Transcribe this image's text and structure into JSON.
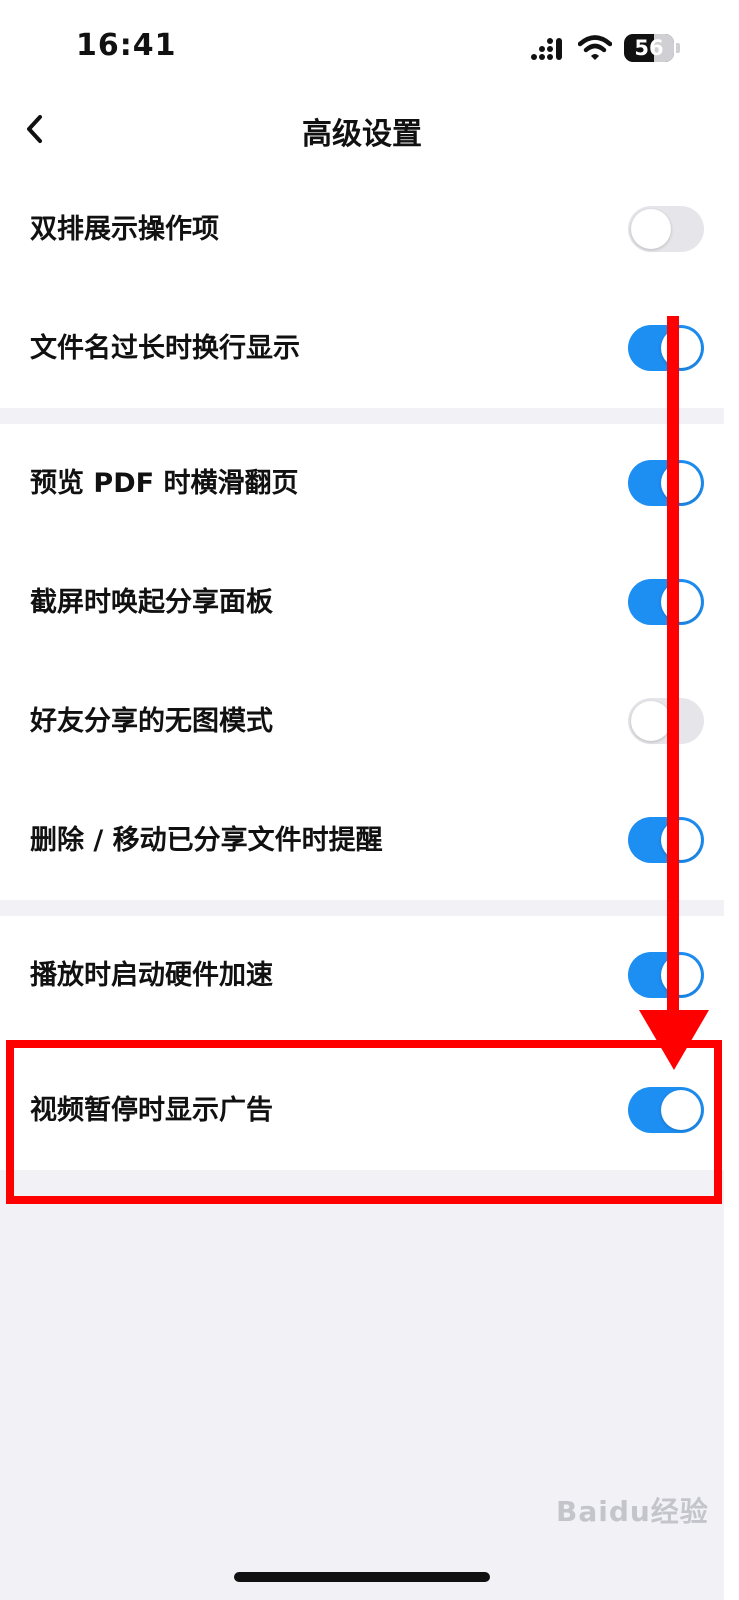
{
  "status_bar": {
    "time": "16:41",
    "battery": "56",
    "signal_icon": "cellular-signal-icon",
    "wifi_icon": "wifi-icon",
    "battery_icon": "battery-icon"
  },
  "nav": {
    "title": "高级设置",
    "back_icon": "chevron-left-icon"
  },
  "sections": [
    {
      "items": [
        {
          "label": "双排展示操作项",
          "on": false
        },
        {
          "label": "文件名过长时换行显示",
          "on": true
        }
      ]
    },
    {
      "items": [
        {
          "label": "预览 PDF 时横滑翻页",
          "on": true
        },
        {
          "label": "截屏时唤起分享面板",
          "on": true
        },
        {
          "label": "好友分享的无图模式",
          "on": false
        },
        {
          "label": "删除 / 移动已分享文件时提醒",
          "on": true
        }
      ]
    },
    {
      "items": [
        {
          "label": "播放时启动硬件加速",
          "on": true
        },
        {
          "label": "视频暂停时显示广告",
          "on": true
        }
      ]
    }
  ],
  "colors": {
    "toggle_on": "#1d8ef2",
    "toggle_off": "#e6e6ea",
    "annotation": "#ff0000",
    "background": "#f2f2f6"
  },
  "watermark": "Baidu经验"
}
